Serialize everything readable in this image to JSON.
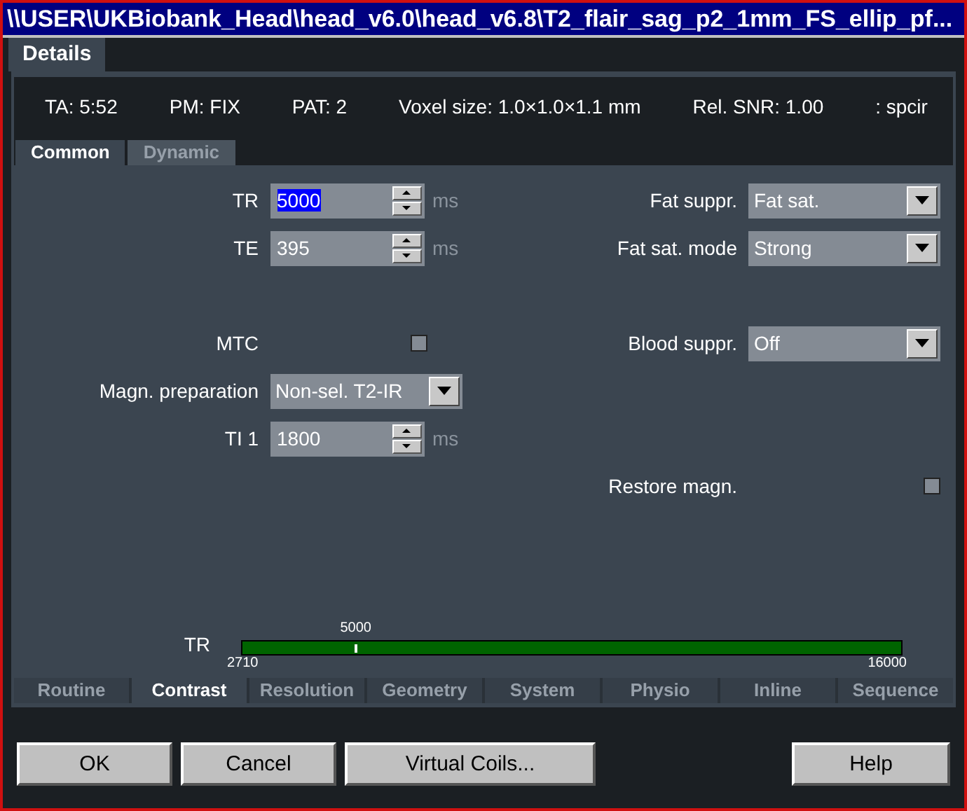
{
  "window": {
    "title": "\\\\USER\\UKBiobank_Head\\head_v6.0\\head_v6.8\\T2_flair_sag_p2_1mm_FS_ellip_pf..."
  },
  "tabs": [
    {
      "label": "Details",
      "selected": true
    }
  ],
  "info": [
    "TA: 5:52",
    "PM: FIX",
    "PAT: 2",
    "Voxel size: 1.0×1.0×1.1 mm",
    "Rel. SNR: 1.00",
    ": spcir"
  ],
  "subtabs": [
    {
      "label": "Common",
      "selected": true
    },
    {
      "label": "Dynamic",
      "selected": false
    }
  ],
  "left": [
    {
      "kind": "spinner",
      "label": "TR",
      "value": "5000",
      "unit": "ms",
      "text_selected": true
    },
    {
      "kind": "spinner",
      "label": "TE",
      "value": "395",
      "unit": "ms",
      "text_selected": false
    },
    {
      "kind": "checkbox",
      "label": "MTC",
      "checked": false
    },
    {
      "kind": "dropdown",
      "label": "Magn. preparation",
      "value": "Non-sel. T2-IR"
    },
    {
      "kind": "spinner",
      "label": "TI 1",
      "value": "1800",
      "unit": "ms",
      "text_selected": false
    }
  ],
  "right": [
    {
      "kind": "dropdown",
      "label": "Fat suppr.",
      "value": "Fat sat."
    },
    {
      "kind": "dropdown",
      "label": "Fat sat. mode",
      "value": "Strong"
    },
    {
      "kind": "dropdown",
      "label": "Blood suppr.",
      "value": "Off"
    },
    {
      "kind": "checkbox",
      "label": "Restore magn.",
      "checked": false
    }
  ],
  "slider": {
    "label": "TR",
    "value": "5000",
    "min": "2710",
    "max": "16000",
    "level": 0.172
  },
  "bottom_tabs": [
    {
      "label": "Routine",
      "selected": false
    },
    {
      "label": "Contrast",
      "selected": true
    },
    {
      "label": "Resolution",
      "selected": false
    },
    {
      "label": "Geometry",
      "selected": false
    },
    {
      "label": "System",
      "selected": false
    },
    {
      "label": "Physio",
      "selected": false
    },
    {
      "label": "Inline",
      "selected": false
    },
    {
      "label": "Sequence",
      "selected": false
    }
  ],
  "buttons": [
    {
      "label": "OK"
    },
    {
      "label": "Cancel"
    },
    {
      "label": "Virtual Coils..."
    },
    {
      "label": "Help"
    }
  ]
}
